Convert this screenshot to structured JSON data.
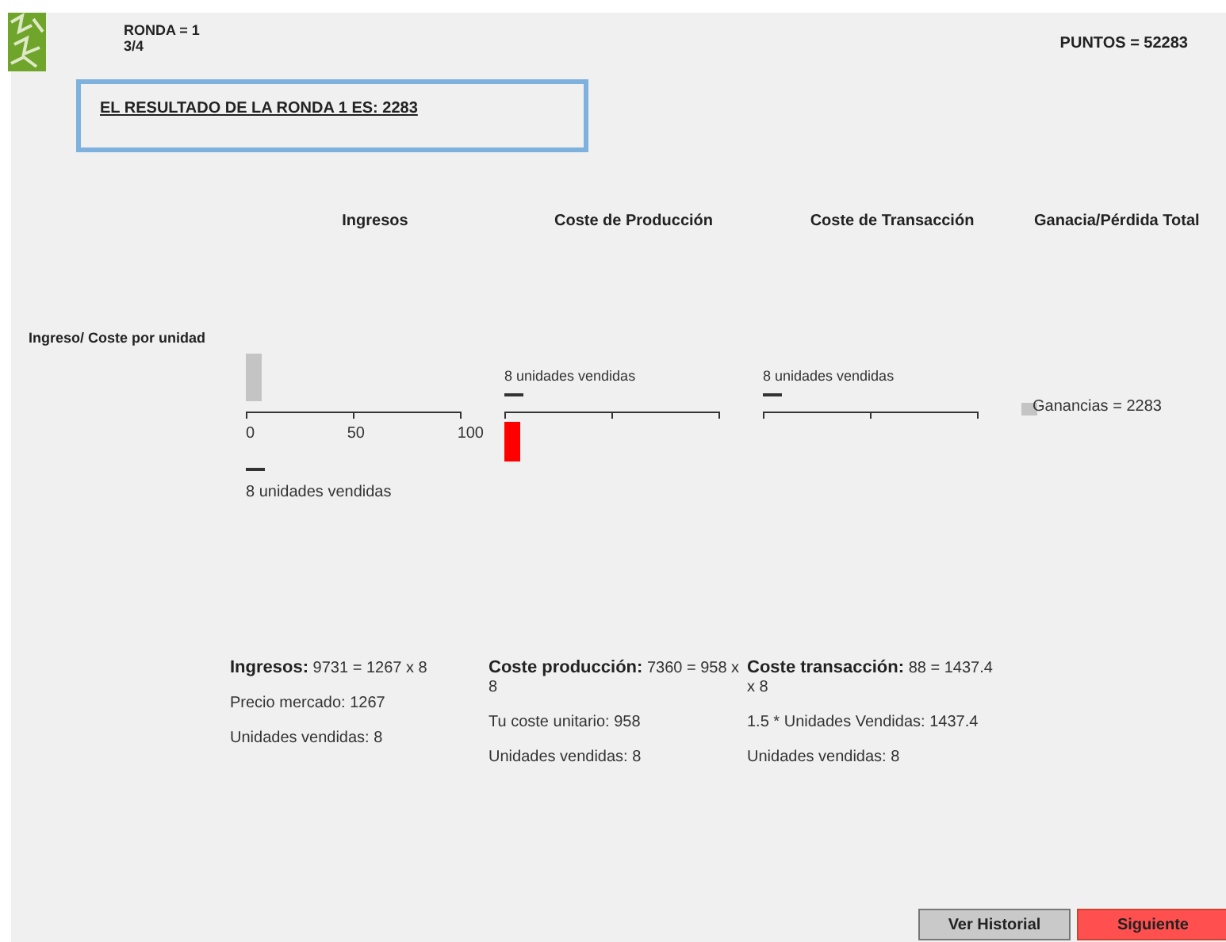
{
  "header": {
    "round": "RONDA =  1",
    "progress": "3/4",
    "points": "PUNTOS =  52283"
  },
  "result": "EL RESULTADO DE LA RONDA 1 ES: 2283",
  "columns": [
    "Ingresos",
    "Coste de Producción",
    "Coste de Transacción",
    "Ganacia/Pérdida Total"
  ],
  "row_label": "Ingreso/ Coste por unidad",
  "mini_charts": [
    {
      "kind": "ingresos",
      "ticks": [
        "0",
        "50",
        "100"
      ],
      "caption": "8 unidades vendidas"
    },
    {
      "kind": "produccion",
      "caption": "8 unidades vendidas"
    },
    {
      "kind": "transaccion",
      "caption": "8 unidades vendidas"
    },
    {
      "kind": "total",
      "caption": "Ganancias = 2283"
    }
  ],
  "details": [
    {
      "title": "Ingresos:",
      "formula": "9731 = 1267 x 8",
      "lines": [
        "Precio mercado: 1267",
        "Unidades vendidas: 8"
      ]
    },
    {
      "title": "Coste producción:",
      "formula": "7360 = 958 x 8",
      "lines": [
        "Tu coste unitario: 958",
        "Unidades vendidas: 8"
      ]
    },
    {
      "title": "Coste transacción:",
      "formula": "88 = 1437.4 x 8",
      "lines": [
        "1.5 * Unidades Vendidas: 1437.4",
        "Unidades vendidas: 8"
      ]
    }
  ],
  "buttons": [
    {
      "label": "Ver Historial",
      "kind": "secondary"
    },
    {
      "label": "Siguiente",
      "kind": "primary"
    }
  ]
}
